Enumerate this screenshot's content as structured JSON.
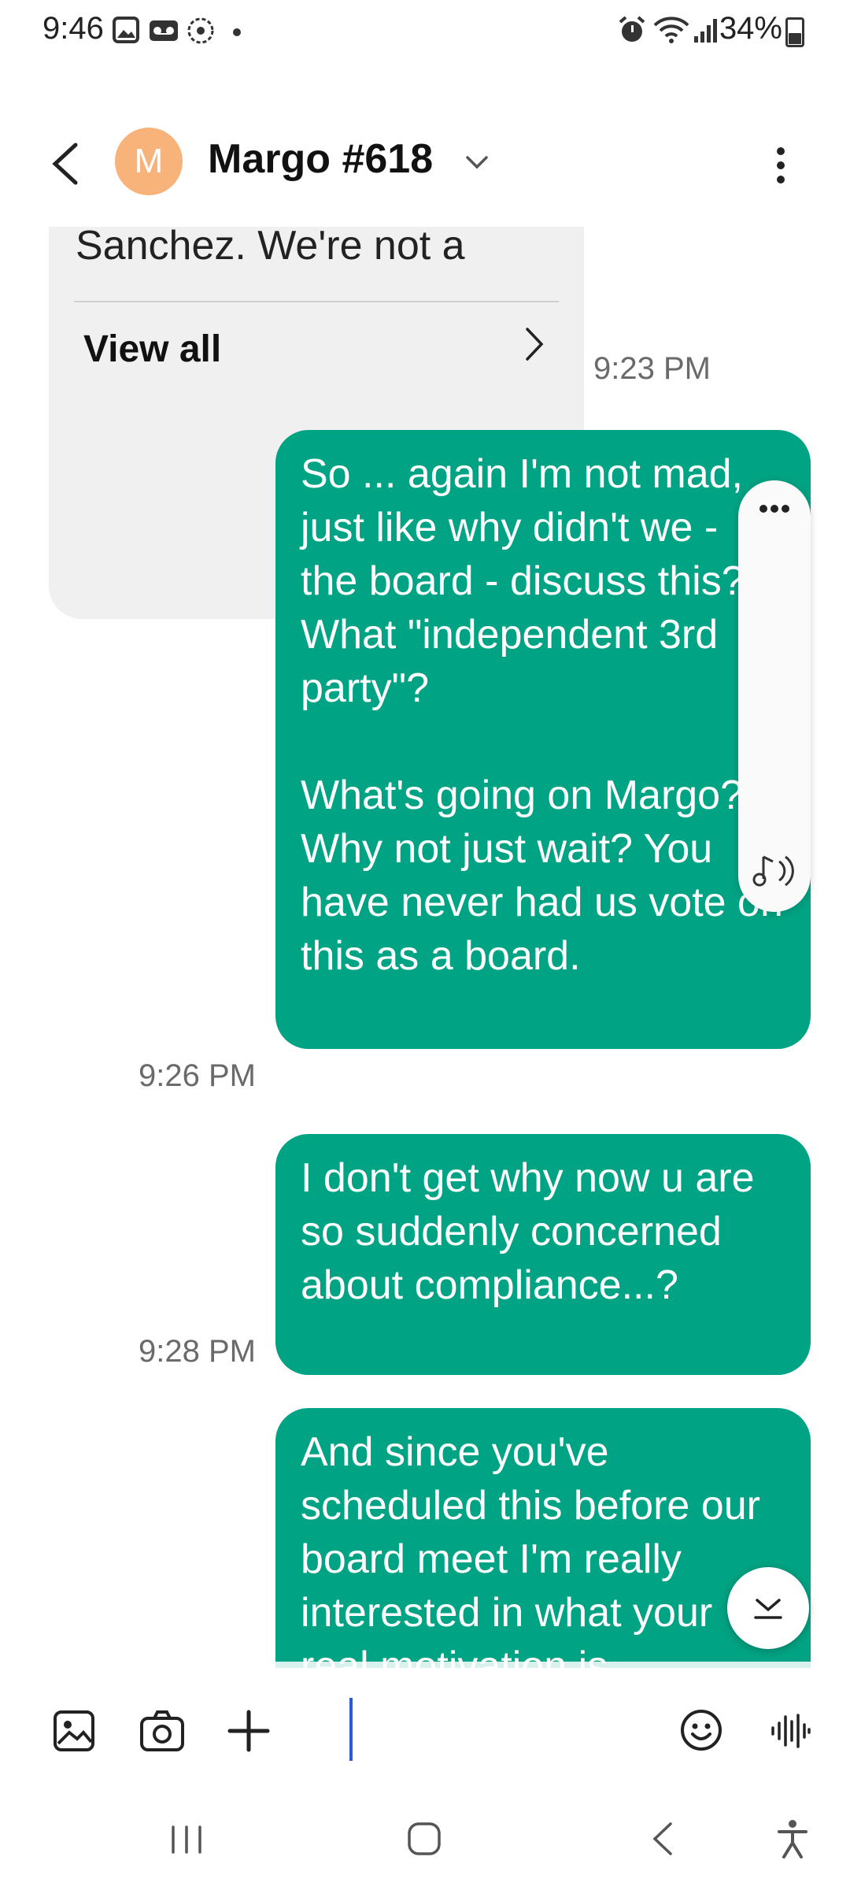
{
  "status_bar": {
    "time": "9:46",
    "battery": "34%"
  },
  "header": {
    "contact_initial": "M",
    "contact_name": "Margo #618"
  },
  "incoming": {
    "text": "Sanchez. We're not a",
    "view_all": "View all",
    "timestamp": "9:23 PM"
  },
  "messages": [
    {
      "text": "So ... again I'm not mad, just like why didn't we - the board - discuss this? What \"independent 3rd party\"?\n\nWhat's going on Margo? Why not just wait? You have never had us vote on this as a board.",
      "timestamp": "9:26 PM"
    },
    {
      "text": "I don't get why now u are so suddenly concerned about compliance...?",
      "timestamp": "9:28 PM"
    },
    {
      "text": "And since you've scheduled this before our board meet I'm really interested in what your real motivation is.\nPlease, don't toss me",
      "timestamp": ""
    }
  ],
  "compose": {
    "placeholder": ""
  },
  "colors": {
    "sent_bubble": "#00A383",
    "avatar": "#F8B37A",
    "incoming_bubble": "#F0F0F0"
  },
  "icons": {
    "back": "chevron-left-icon",
    "more": "vertical-dots-icon",
    "gallery": "image-icon",
    "camera": "camera-icon",
    "add": "plus-icon",
    "emoji": "emoji-icon",
    "voice": "voice-wave-icon"
  }
}
